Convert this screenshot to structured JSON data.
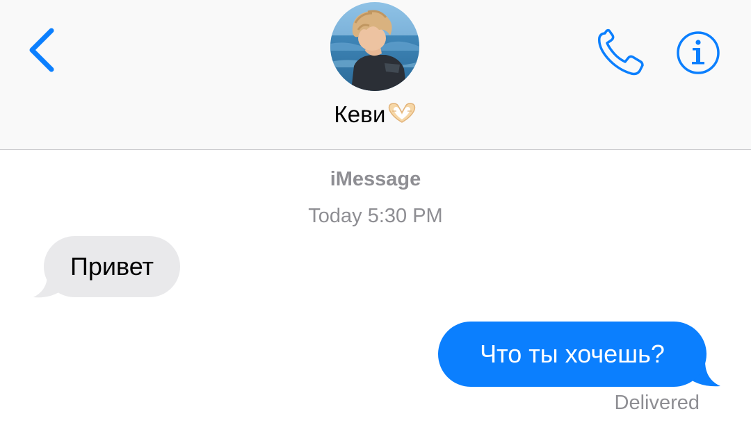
{
  "header": {
    "contact_name": "Кеви",
    "contact_emoji": "🫶",
    "avatar": "contact-photo",
    "icons": {
      "back": "chevron-left-icon",
      "call": "phone-icon",
      "info": "info-icon"
    }
  },
  "conversation": {
    "service": "iMessage",
    "timestamp": "Today 5:30 PM",
    "messages": [
      {
        "direction": "incoming",
        "text": "Привет"
      },
      {
        "direction": "outgoing",
        "text": "Что ты хочешь?"
      }
    ],
    "status": "Delivered"
  },
  "colors": {
    "accent": "#0b7ffe",
    "incoming_bubble": "#e9e9eb",
    "secondary_text": "#8e8e93",
    "header_bg": "#f9f9f9"
  }
}
